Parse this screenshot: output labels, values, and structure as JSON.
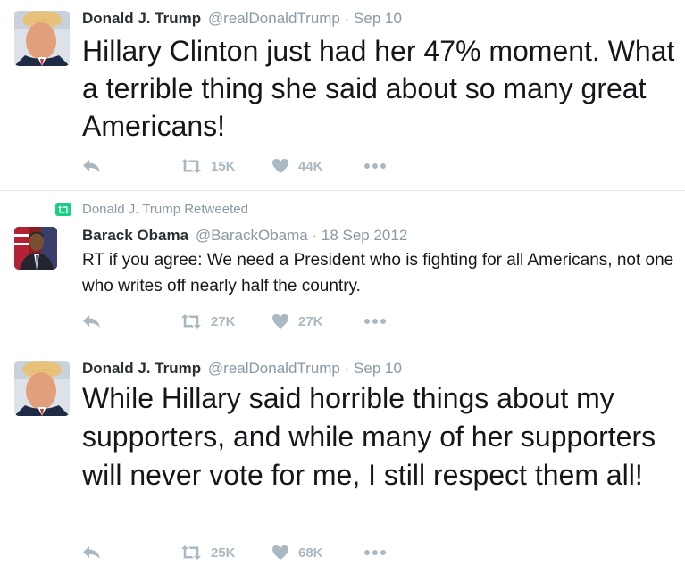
{
  "tweets": [
    {
      "name": "Donald J. Trump",
      "handle": "@realDonaldTrump",
      "separator": "·",
      "date": "Sep 10",
      "text": "Hillary Clinton just had her 47% moment. What a terrible thing she said about so many great Americans!",
      "retweets": "15K",
      "likes": "44K"
    },
    {
      "retweet_context": "Donald J. Trump Retweeted",
      "name": "Barack Obama",
      "handle": "@BarackObama",
      "separator": "·",
      "date": "18 Sep 2012",
      "text": "RT if you agree: We need a President who is fighting for all Americans, not one who writes off nearly half the country.",
      "retweets": "27K",
      "likes": "27K"
    },
    {
      "name": "Donald J. Trump",
      "handle": "@realDonaldTrump",
      "separator": "·",
      "date": "Sep 10",
      "text": "While Hillary said horrible things about my supporters, and while many of her supporters will never vote for me, I still respect them all!",
      "retweets": "25K",
      "likes": "68K"
    }
  ],
  "icons": {
    "reply": "reply-icon",
    "retweet": "retweet-icon",
    "like": "heart-icon",
    "more": "more-icon",
    "retweet_context": "retweet-badge-icon"
  },
  "colors": {
    "icon_gray": "#aab8c2",
    "meta_gray": "#8899a6",
    "retweet_green": "#19cf86",
    "divider": "#e1e8ed"
  }
}
